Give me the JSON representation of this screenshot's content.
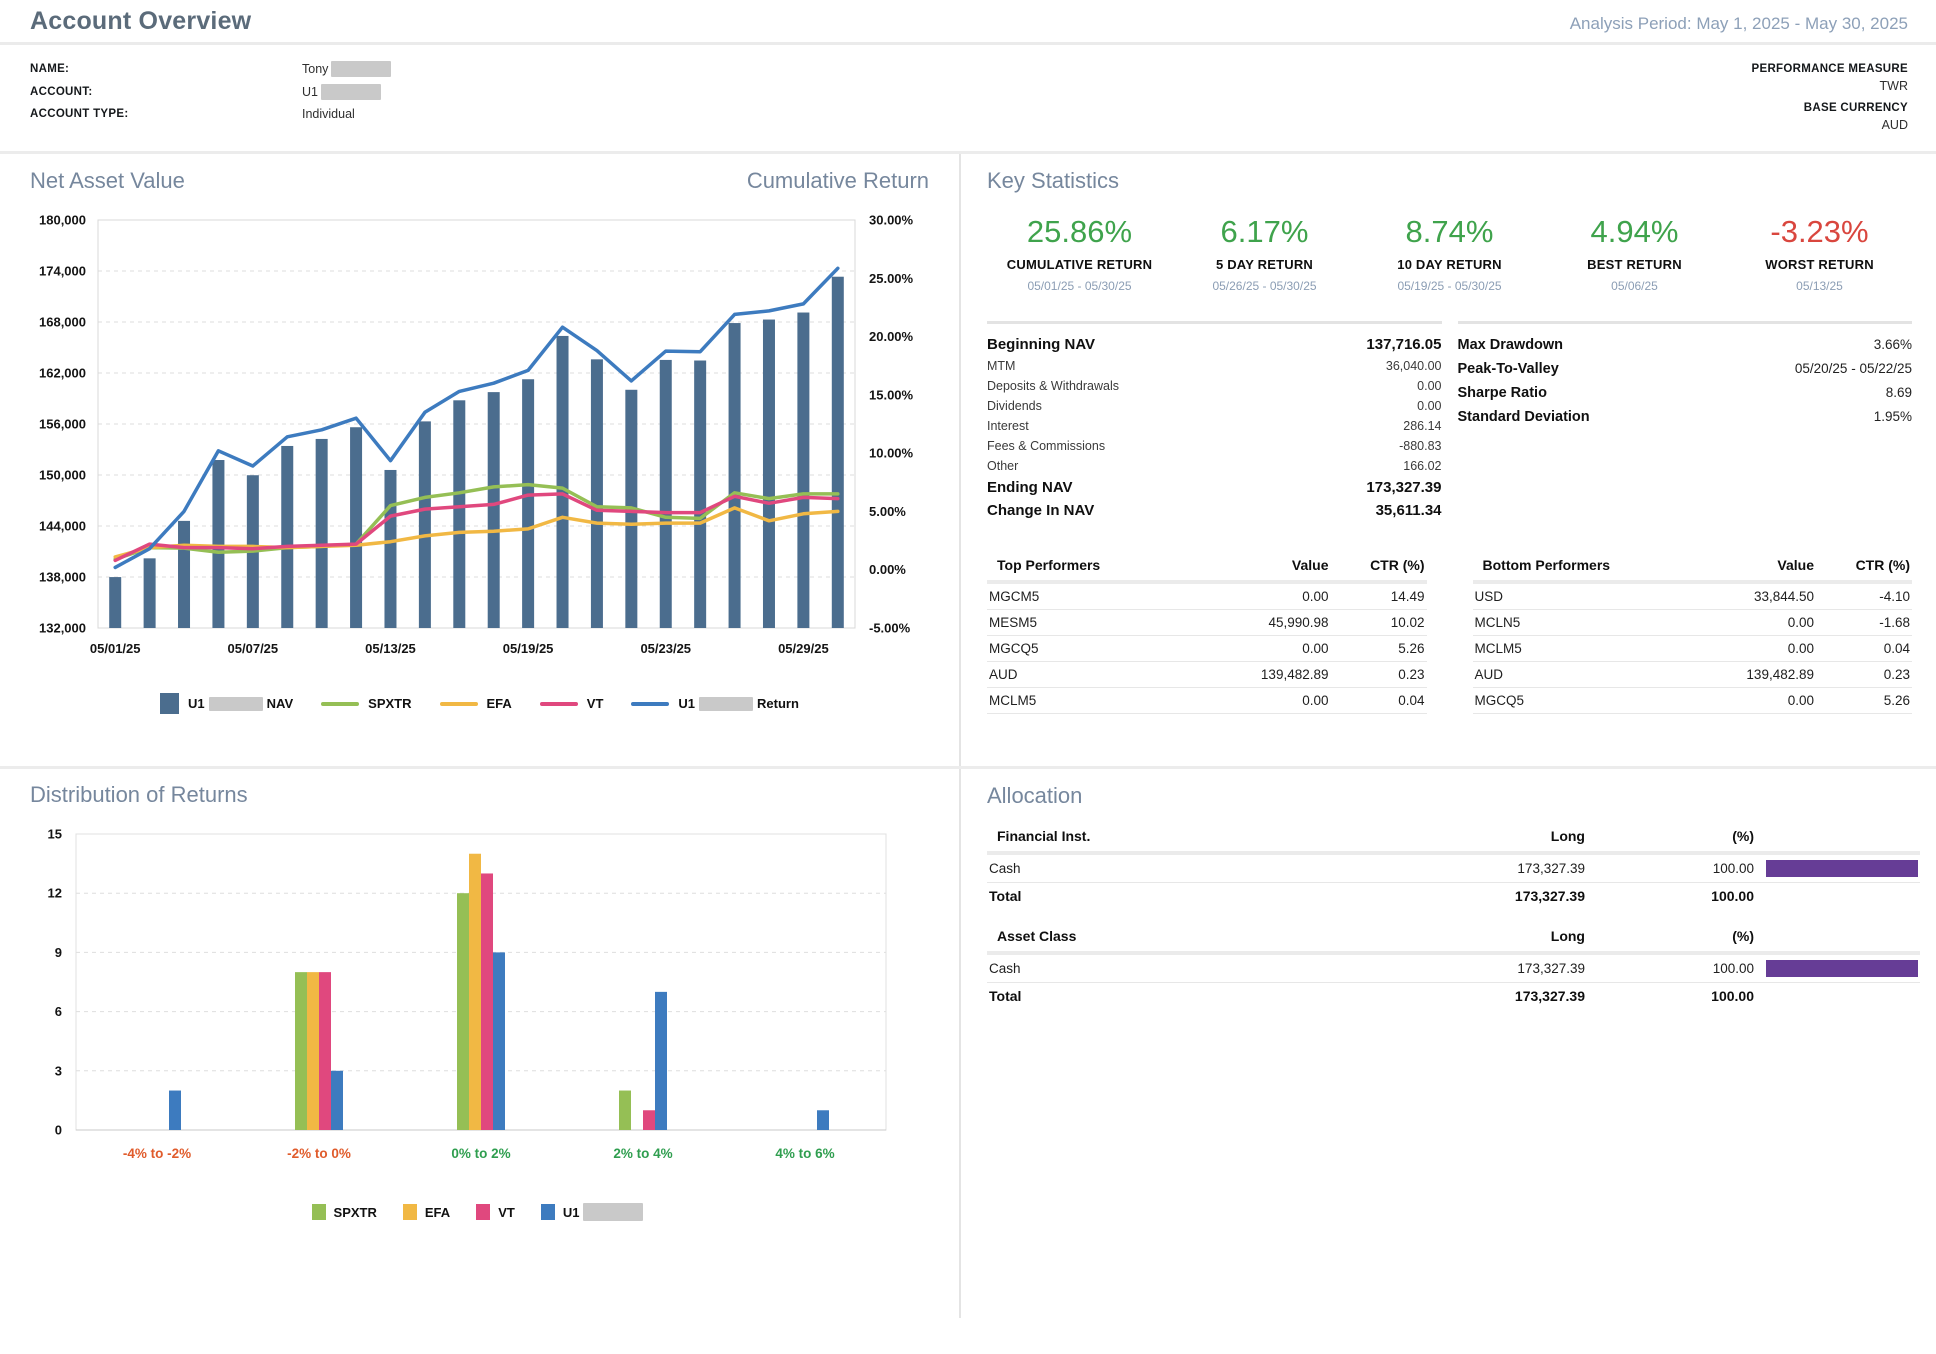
{
  "header": {
    "title": "Account Overview",
    "analysis_period": "Analysis Period: May 1, 2025 - May 30, 2025"
  },
  "account": {
    "name_label": "NAME:",
    "name_value": "Tony",
    "account_label": "ACCOUNT:",
    "account_value": "U1",
    "type_label": "ACCOUNT TYPE:",
    "type_value": "Individual",
    "perf_label": "PERFORMANCE MEASURE",
    "perf_value": "TWR",
    "currency_label": "BASE CURRENCY",
    "currency_value": "AUD"
  },
  "nav_chart": {
    "title_left": "Net Asset Value",
    "title_right": "Cumulative Return",
    "legend": {
      "nav_prefix": "U1",
      "nav_suffix": "NAV",
      "spxtr": "SPXTR",
      "efa": "EFA",
      "vt": "VT",
      "return_prefix": "U1",
      "return_suffix": "Return"
    }
  },
  "key_stats": {
    "title": "Key Statistics",
    "stats": [
      {
        "value": "25.86%",
        "label": "CUMULATIVE RETURN",
        "period": "05/01/25 - 05/30/25",
        "positive": true
      },
      {
        "value": "6.17%",
        "label": "5 DAY RETURN",
        "period": "05/26/25 - 05/30/25",
        "positive": true
      },
      {
        "value": "8.74%",
        "label": "10 DAY RETURN",
        "period": "05/19/25 - 05/30/25",
        "positive": true
      },
      {
        "value": "4.94%",
        "label": "BEST RETURN",
        "period": "05/06/25",
        "positive": true
      },
      {
        "value": "-3.23%",
        "label": "WORST RETURN",
        "period": "05/13/25",
        "positive": false
      }
    ],
    "breakdown": [
      {
        "label": "Beginning NAV",
        "value": "137,716.05"
      },
      {
        "label": "MTM",
        "value": "36,040.00"
      },
      {
        "label": "Deposits & Withdrawals",
        "value": "0.00"
      },
      {
        "label": "Dividends",
        "value": "0.00"
      },
      {
        "label": "Interest",
        "value": "286.14"
      },
      {
        "label": "Fees & Commissions",
        "value": "-880.83"
      },
      {
        "label": "Other",
        "value": "166.02"
      },
      {
        "label": "Ending NAV",
        "value": "173,327.39"
      },
      {
        "label": "Change In NAV",
        "value": "35,611.34"
      }
    ],
    "risk": [
      {
        "label": "Max Drawdown",
        "value": "3.66%"
      },
      {
        "label": "Peak-To-Valley",
        "value": "05/20/25 - 05/22/25"
      },
      {
        "label": "Sharpe Ratio",
        "value": "8.69"
      },
      {
        "label": "Standard Deviation",
        "value": "1.95%"
      }
    ],
    "top_performers": {
      "title": "Top Performers",
      "col_value": "Value",
      "col_ctr": "CTR (%)",
      "rows": [
        [
          "MGCM5",
          "0.00",
          "14.49"
        ],
        [
          "MESM5",
          "45,990.98",
          "10.02"
        ],
        [
          "MGCQ5",
          "0.00",
          "5.26"
        ],
        [
          "AUD",
          "139,482.89",
          "0.23"
        ],
        [
          "MCLM5",
          "0.00",
          "0.04"
        ]
      ]
    },
    "bottom_performers": {
      "title": "Bottom Performers",
      "col_value": "Value",
      "col_ctr": "CTR (%)",
      "rows": [
        [
          "USD",
          "33,844.50",
          "-4.10"
        ],
        [
          "MCLN5",
          "0.00",
          "-1.68"
        ],
        [
          "MCLM5",
          "0.00",
          "0.04"
        ],
        [
          "AUD",
          "139,482.89",
          "0.23"
        ],
        [
          "MGCQ5",
          "0.00",
          "5.26"
        ]
      ]
    }
  },
  "distribution": {
    "title": "Distribution of Returns",
    "legend": {
      "spxtr": "SPXTR",
      "efa": "EFA",
      "vt": "VT",
      "account_prefix": "U1"
    }
  },
  "allocation": {
    "title": "Allocation",
    "tables": [
      {
        "name_header": "Financial Inst.",
        "long_header": "Long",
        "pct_header": "(%)",
        "rows": [
          {
            "name": "Cash",
            "long": "173,327.39",
            "pct": "100.00",
            "bar_pct": 100
          }
        ],
        "total": {
          "name": "Total",
          "long": "173,327.39",
          "pct": "100.00"
        }
      },
      {
        "name_header": "Asset Class",
        "long_header": "Long",
        "pct_header": "(%)",
        "rows": [
          {
            "name": "Cash",
            "long": "173,327.39",
            "pct": "100.00",
            "bar_pct": 100
          }
        ],
        "total": {
          "name": "Total",
          "long": "173,327.39",
          "pct": "100.00"
        }
      }
    ]
  },
  "colors": {
    "positive": "#3fa34c",
    "negative": "#d9463e",
    "nav_bar": "#4b6d8e",
    "spxtr": "#95bf55",
    "efa": "#f1b844",
    "vt": "#e0487e",
    "return_line": "#3d7bbf",
    "alloc_bar": "#663d96",
    "neg_bucket": "#e05b2b",
    "pos_bucket": "#2f9e4f",
    "grid": "#dedede",
    "axis_text": "#141414"
  },
  "chart_data": [
    {
      "type": "bar+line",
      "title": "Net Asset Value / Cumulative Return",
      "dates": [
        "05/01/25",
        "05/02/25",
        "05/05/25",
        "05/06/25",
        "05/07/25",
        "05/08/25",
        "05/09/25",
        "05/12/25",
        "05/13/25",
        "05/14/25",
        "05/15/25",
        "05/16/25",
        "05/19/25",
        "05/20/25",
        "05/21/25",
        "05/22/25",
        "05/23/25",
        "05/26/25",
        "05/27/25",
        "05/28/25",
        "05/29/25",
        "05/30/25"
      ],
      "x_tick_indices": [
        0,
        4,
        8,
        12,
        16,
        20
      ],
      "left_axis": {
        "min": 132000,
        "max": 180000,
        "step": 6000,
        "label": "Net Asset Value"
      },
      "right_axis": {
        "min": -5,
        "max": 30,
        "step": 5,
        "label": "Cumulative Return"
      },
      "nav_bars": [
        137991,
        140195,
        144602,
        151763,
        149973,
        153416,
        154242,
        155619,
        150592,
        156308,
        158787,
        159751,
        161265,
        166361,
        163607,
        160026,
        163538,
        163469,
        167876,
        168289,
        169115,
        173327
      ],
      "series": [
        {
          "name": "SPXTR",
          "color_key": "spxtr",
          "values": [
            0.9,
            1.9,
            1.85,
            1.5,
            1.6,
            1.9,
            2.0,
            2.2,
            5.5,
            6.2,
            6.6,
            7.1,
            7.3,
            7.0,
            5.4,
            5.3,
            4.5,
            4.4,
            6.6,
            6.1,
            6.5,
            6.5
          ]
        },
        {
          "name": "EFA",
          "color_key": "efa",
          "values": [
            1.1,
            1.9,
            2.1,
            2.0,
            2.0,
            1.9,
            2.0,
            2.1,
            2.4,
            2.9,
            3.2,
            3.3,
            3.5,
            4.5,
            4.0,
            3.9,
            4.0,
            4.0,
            5.3,
            4.2,
            4.8,
            5.0
          ]
        },
        {
          "name": "VT",
          "color_key": "vt",
          "values": [
            0.8,
            2.2,
            1.9,
            1.9,
            1.8,
            2.0,
            2.1,
            2.2,
            4.6,
            5.2,
            5.4,
            5.6,
            6.4,
            6.5,
            5.1,
            5.0,
            4.9,
            4.9,
            6.3,
            5.7,
            6.2,
            6.1
          ]
        },
        {
          "name": "U1 Return",
          "color_key": "return_line",
          "values": [
            0.2,
            1.8,
            5.0,
            10.2,
            8.9,
            11.4,
            12.0,
            13.0,
            9.35,
            13.5,
            15.3,
            16.0,
            17.1,
            20.8,
            18.8,
            16.2,
            18.75,
            18.7,
            21.9,
            22.2,
            22.8,
            25.86
          ]
        }
      ]
    },
    {
      "type": "bar",
      "title": "Distribution of Returns",
      "categories": [
        "-4% to -2%",
        "-2% to 0%",
        "0% to 2%",
        "2% to 4%",
        "4% to 6%"
      ],
      "category_color_keys": [
        "neg_bucket",
        "neg_bucket",
        "pos_bucket",
        "pos_bucket",
        "pos_bucket"
      ],
      "ylim": [
        0,
        15
      ],
      "yticks": [
        0,
        3,
        6,
        9,
        12,
        15
      ],
      "series": [
        {
          "name": "SPXTR",
          "color_key": "spxtr",
          "values": [
            0,
            8,
            12,
            2,
            0
          ]
        },
        {
          "name": "EFA",
          "color_key": "efa",
          "values": [
            0,
            8,
            14,
            0,
            0
          ]
        },
        {
          "name": "VT",
          "color_key": "vt",
          "values": [
            0,
            8,
            13,
            1,
            0
          ]
        },
        {
          "name": "U1",
          "color_key": "return_line",
          "values": [
            2,
            3,
            9,
            7,
            1
          ]
        }
      ]
    }
  ]
}
